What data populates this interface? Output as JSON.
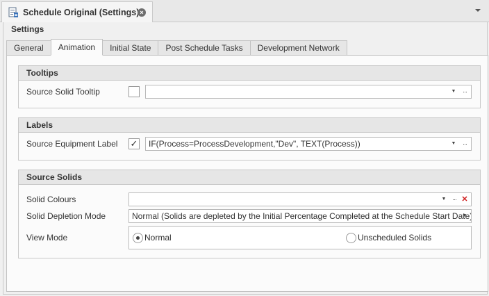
{
  "document_tab": {
    "title": "Schedule Original (Settings)",
    "icon": "settings-document-icon",
    "close_icon": "close-icon"
  },
  "panel": {
    "title": "Settings"
  },
  "tabs": [
    {
      "label": "General",
      "active": false
    },
    {
      "label": "Animation",
      "active": true
    },
    {
      "label": "Initial State",
      "active": false
    },
    {
      "label": "Post Schedule Tasks",
      "active": false
    },
    {
      "label": "Development Network",
      "active": false
    }
  ],
  "tooltips": {
    "header": "Tooltips",
    "source_solid_tooltip": {
      "label": "Source Solid Tooltip",
      "checked": false,
      "value": ""
    }
  },
  "labels": {
    "header": "Labels",
    "source_equipment_label": {
      "label": "Source Equipment Label",
      "checked": true,
      "value": "IF(Process=ProcessDevelopment,\"Dev\", TEXT(Process))"
    }
  },
  "source_solids": {
    "header": "Source Solids",
    "solid_colours": {
      "label": "Solid Colours",
      "value": ""
    },
    "solid_depletion_mode": {
      "label": "Solid Depletion Mode",
      "value": "Normal (Solids are depleted by the Initial Percentage Completed at the Schedule Start Date)"
    },
    "view_mode": {
      "label": "View Mode",
      "options": [
        {
          "label": "Normal",
          "selected": true
        },
        {
          "label": "Unscheduled Solids",
          "selected": false
        }
      ]
    }
  },
  "glyphs": {
    "dropdown_arrow": "▼",
    "ellipsis": "···",
    "clear": "✕",
    "check": "✓",
    "close": "×"
  }
}
